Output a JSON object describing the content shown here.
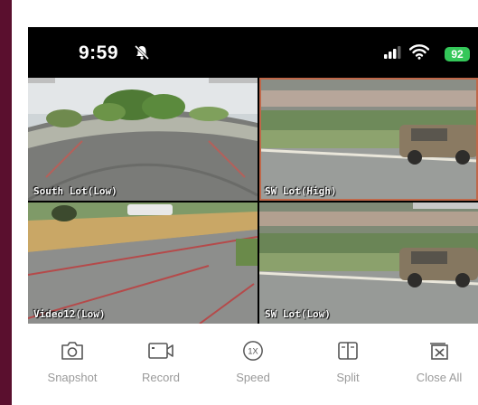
{
  "status_bar": {
    "time": "9:59",
    "battery": "92"
  },
  "cameras": [
    {
      "label": "South Lot(Low)",
      "selected": false
    },
    {
      "label": "SW Lot(High)",
      "selected": true
    },
    {
      "label": "Video12(Low)",
      "selected": false
    },
    {
      "label": "SW Lot(Low)",
      "selected": false
    }
  ],
  "toolbar": {
    "items": [
      {
        "label": "Snapshot",
        "icon": "camera-icon"
      },
      {
        "label": "Record",
        "icon": "video-icon"
      },
      {
        "label": "Speed",
        "icon": "speed-1x-icon"
      },
      {
        "label": "Split",
        "icon": "split-icon"
      },
      {
        "label": "Close All",
        "icon": "close-all-icon"
      }
    ],
    "speed_glyph": "1X"
  },
  "colors": {
    "accent_border": "#c0684a",
    "battery": "#34c759",
    "frame": "#5a0f2e"
  }
}
